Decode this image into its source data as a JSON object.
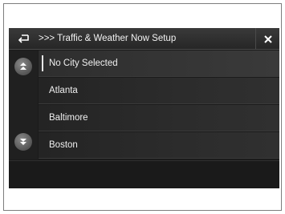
{
  "header": {
    "title": ">>> Traffic & Weather Now Setup",
    "back_icon": "back-arrow-icon",
    "close_label": "×"
  },
  "list": {
    "items": [
      {
        "label": "No City Selected",
        "selected": true
      },
      {
        "label": "Atlanta",
        "selected": false
      },
      {
        "label": "Baltimore",
        "selected": false
      },
      {
        "label": "Boston",
        "selected": false
      }
    ]
  },
  "colors": {
    "screen_bg": "#1b1b1b",
    "header_bg": "#2e2e2e",
    "text": "#f0f0f0",
    "scroll_button": "#6e6e6e"
  }
}
